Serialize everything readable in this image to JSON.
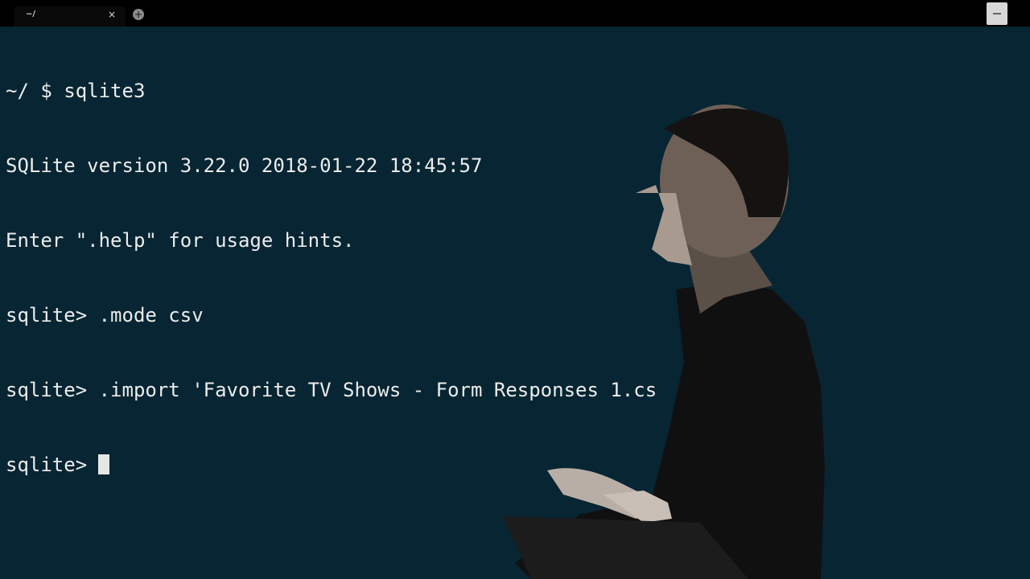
{
  "tab": {
    "title": "~/",
    "close_label": "×",
    "new_tab_label": "+"
  },
  "terminal": {
    "lines": [
      "~/ $ sqlite3",
      "SQLite version 3.22.0 2018-01-22 18:45:57",
      "Enter \".help\" for usage hints.",
      "sqlite> .mode csv",
      "sqlite> .import 'Favorite TV Shows - Form Responses 1.cs",
      "sqlite>"
    ]
  },
  "colors": {
    "background": "#072532",
    "text": "#ececec",
    "tabbar": "#000000"
  },
  "icons": {
    "close": "close-icon",
    "new_tab": "plus-circle-icon",
    "scroll": "scroll-icon"
  }
}
